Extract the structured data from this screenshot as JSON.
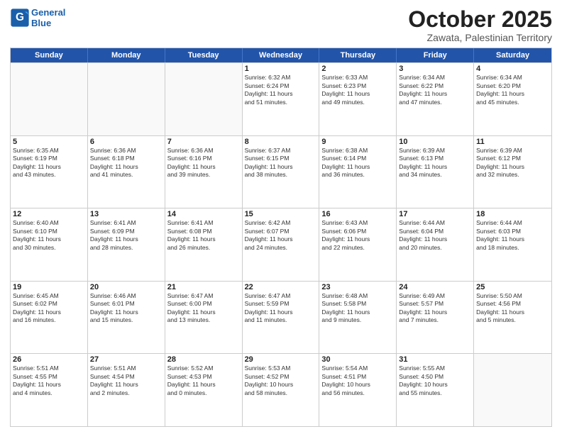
{
  "header": {
    "logo_line1": "General",
    "logo_line2": "Blue",
    "month": "October 2025",
    "location": "Zawata, Palestinian Territory"
  },
  "weekdays": [
    "Sunday",
    "Monday",
    "Tuesday",
    "Wednesday",
    "Thursday",
    "Friday",
    "Saturday"
  ],
  "rows": [
    [
      {
        "day": "",
        "lines": [],
        "empty": true
      },
      {
        "day": "",
        "lines": [],
        "empty": true
      },
      {
        "day": "",
        "lines": [],
        "empty": true
      },
      {
        "day": "1",
        "lines": [
          "Sunrise: 6:32 AM",
          "Sunset: 6:24 PM",
          "Daylight: 11 hours",
          "and 51 minutes."
        ]
      },
      {
        "day": "2",
        "lines": [
          "Sunrise: 6:33 AM",
          "Sunset: 6:23 PM",
          "Daylight: 11 hours",
          "and 49 minutes."
        ]
      },
      {
        "day": "3",
        "lines": [
          "Sunrise: 6:34 AM",
          "Sunset: 6:22 PM",
          "Daylight: 11 hours",
          "and 47 minutes."
        ]
      },
      {
        "day": "4",
        "lines": [
          "Sunrise: 6:34 AM",
          "Sunset: 6:20 PM",
          "Daylight: 11 hours",
          "and 45 minutes."
        ]
      }
    ],
    [
      {
        "day": "5",
        "lines": [
          "Sunrise: 6:35 AM",
          "Sunset: 6:19 PM",
          "Daylight: 11 hours",
          "and 43 minutes."
        ]
      },
      {
        "day": "6",
        "lines": [
          "Sunrise: 6:36 AM",
          "Sunset: 6:18 PM",
          "Daylight: 11 hours",
          "and 41 minutes."
        ]
      },
      {
        "day": "7",
        "lines": [
          "Sunrise: 6:36 AM",
          "Sunset: 6:16 PM",
          "Daylight: 11 hours",
          "and 39 minutes."
        ]
      },
      {
        "day": "8",
        "lines": [
          "Sunrise: 6:37 AM",
          "Sunset: 6:15 PM",
          "Daylight: 11 hours",
          "and 38 minutes."
        ]
      },
      {
        "day": "9",
        "lines": [
          "Sunrise: 6:38 AM",
          "Sunset: 6:14 PM",
          "Daylight: 11 hours",
          "and 36 minutes."
        ]
      },
      {
        "day": "10",
        "lines": [
          "Sunrise: 6:39 AM",
          "Sunset: 6:13 PM",
          "Daylight: 11 hours",
          "and 34 minutes."
        ]
      },
      {
        "day": "11",
        "lines": [
          "Sunrise: 6:39 AM",
          "Sunset: 6:12 PM",
          "Daylight: 11 hours",
          "and 32 minutes."
        ]
      }
    ],
    [
      {
        "day": "12",
        "lines": [
          "Sunrise: 6:40 AM",
          "Sunset: 6:10 PM",
          "Daylight: 11 hours",
          "and 30 minutes."
        ]
      },
      {
        "day": "13",
        "lines": [
          "Sunrise: 6:41 AM",
          "Sunset: 6:09 PM",
          "Daylight: 11 hours",
          "and 28 minutes."
        ]
      },
      {
        "day": "14",
        "lines": [
          "Sunrise: 6:41 AM",
          "Sunset: 6:08 PM",
          "Daylight: 11 hours",
          "and 26 minutes."
        ]
      },
      {
        "day": "15",
        "lines": [
          "Sunrise: 6:42 AM",
          "Sunset: 6:07 PM",
          "Daylight: 11 hours",
          "and 24 minutes."
        ]
      },
      {
        "day": "16",
        "lines": [
          "Sunrise: 6:43 AM",
          "Sunset: 6:06 PM",
          "Daylight: 11 hours",
          "and 22 minutes."
        ]
      },
      {
        "day": "17",
        "lines": [
          "Sunrise: 6:44 AM",
          "Sunset: 6:04 PM",
          "Daylight: 11 hours",
          "and 20 minutes."
        ]
      },
      {
        "day": "18",
        "lines": [
          "Sunrise: 6:44 AM",
          "Sunset: 6:03 PM",
          "Daylight: 11 hours",
          "and 18 minutes."
        ]
      }
    ],
    [
      {
        "day": "19",
        "lines": [
          "Sunrise: 6:45 AM",
          "Sunset: 6:02 PM",
          "Daylight: 11 hours",
          "and 16 minutes."
        ]
      },
      {
        "day": "20",
        "lines": [
          "Sunrise: 6:46 AM",
          "Sunset: 6:01 PM",
          "Daylight: 11 hours",
          "and 15 minutes."
        ]
      },
      {
        "day": "21",
        "lines": [
          "Sunrise: 6:47 AM",
          "Sunset: 6:00 PM",
          "Daylight: 11 hours",
          "and 13 minutes."
        ]
      },
      {
        "day": "22",
        "lines": [
          "Sunrise: 6:47 AM",
          "Sunset: 5:59 PM",
          "Daylight: 11 hours",
          "and 11 minutes."
        ]
      },
      {
        "day": "23",
        "lines": [
          "Sunrise: 6:48 AM",
          "Sunset: 5:58 PM",
          "Daylight: 11 hours",
          "and 9 minutes."
        ]
      },
      {
        "day": "24",
        "lines": [
          "Sunrise: 6:49 AM",
          "Sunset: 5:57 PM",
          "Daylight: 11 hours",
          "and 7 minutes."
        ]
      },
      {
        "day": "25",
        "lines": [
          "Sunrise: 5:50 AM",
          "Sunset: 4:56 PM",
          "Daylight: 11 hours",
          "and 5 minutes."
        ]
      }
    ],
    [
      {
        "day": "26",
        "lines": [
          "Sunrise: 5:51 AM",
          "Sunset: 4:55 PM",
          "Daylight: 11 hours",
          "and 4 minutes."
        ]
      },
      {
        "day": "27",
        "lines": [
          "Sunrise: 5:51 AM",
          "Sunset: 4:54 PM",
          "Daylight: 11 hours",
          "and 2 minutes."
        ]
      },
      {
        "day": "28",
        "lines": [
          "Sunrise: 5:52 AM",
          "Sunset: 4:53 PM",
          "Daylight: 11 hours",
          "and 0 minutes."
        ]
      },
      {
        "day": "29",
        "lines": [
          "Sunrise: 5:53 AM",
          "Sunset: 4:52 PM",
          "Daylight: 10 hours",
          "and 58 minutes."
        ]
      },
      {
        "day": "30",
        "lines": [
          "Sunrise: 5:54 AM",
          "Sunset: 4:51 PM",
          "Daylight: 10 hours",
          "and 56 minutes."
        ]
      },
      {
        "day": "31",
        "lines": [
          "Sunrise: 5:55 AM",
          "Sunset: 4:50 PM",
          "Daylight: 10 hours",
          "and 55 minutes."
        ]
      },
      {
        "day": "",
        "lines": [],
        "empty": true
      }
    ]
  ]
}
